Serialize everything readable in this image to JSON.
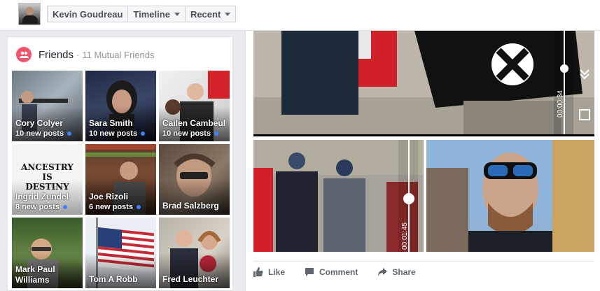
{
  "header": {
    "profile_name": "Kevin Goudreau",
    "timeline_label": "Timeline",
    "recent_label": "Recent"
  },
  "friends": {
    "title": "Friends",
    "separator": "·",
    "mutual": "11 Mutual Friends",
    "accent_color": "#f35369",
    "items": [
      {
        "name": "Cory Colyer",
        "posts": "10 new posts"
      },
      {
        "name": "Sara Smith",
        "posts": "10 new posts"
      },
      {
        "name": "Cailen Cambeul",
        "posts": "10 new posts"
      },
      {
        "name": "Ingrid Zundel",
        "posts": "8 new posts",
        "image_text": "ANCESTRY IS DESTINY"
      },
      {
        "name": "Joe Rizoli",
        "posts": "6 new posts"
      },
      {
        "name": "Brad Salzberg"
      },
      {
        "name": "Mark Paul Williams"
      },
      {
        "name": "Tom A Robb"
      },
      {
        "name": "Fred Leuchter"
      }
    ]
  },
  "post": {
    "video_times": [
      "00:00:34",
      "00:01:45"
    ],
    "actions": {
      "like": "Like",
      "comment": "Comment",
      "share": "Share"
    }
  }
}
